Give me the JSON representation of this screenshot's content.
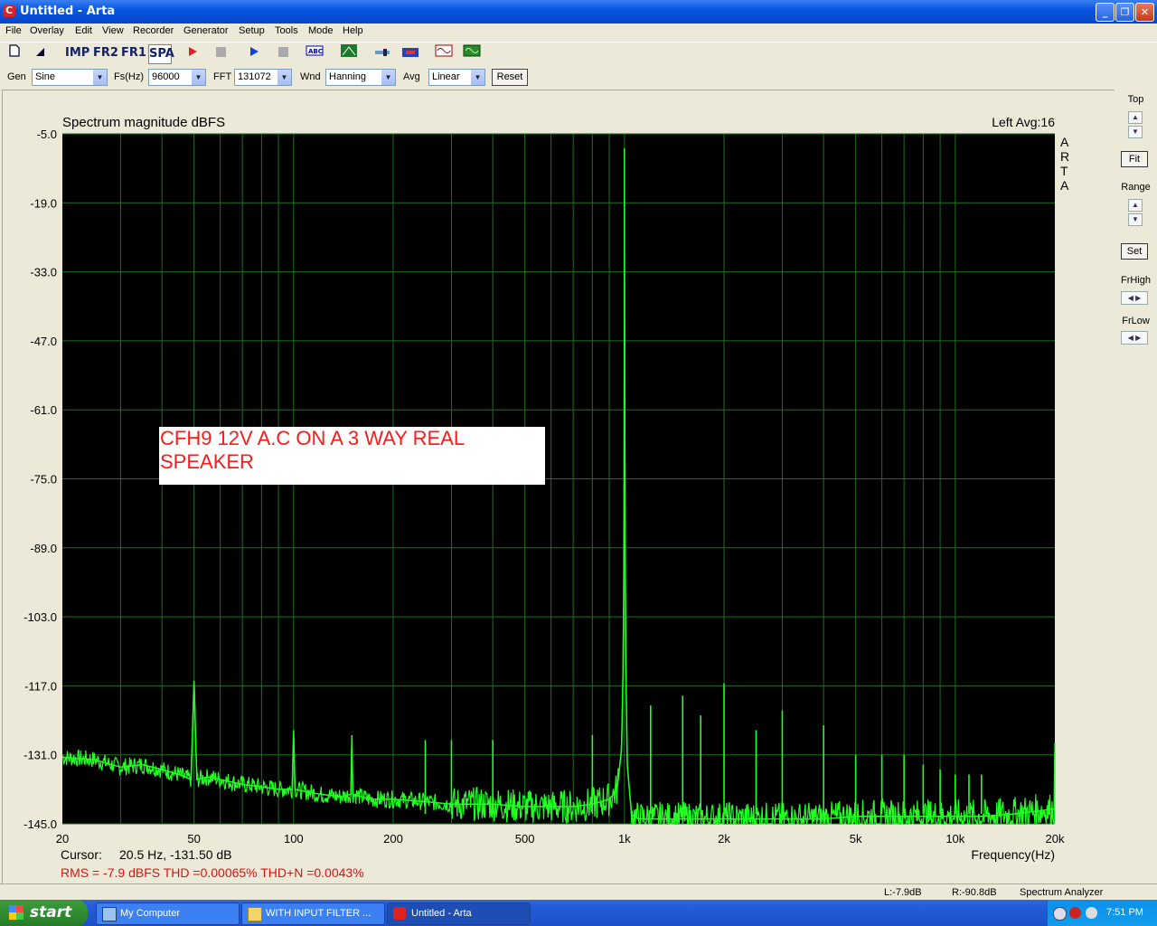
{
  "window": {
    "title": "Untitled - Arta",
    "app_icon_letter": "C",
    "minimize": "_",
    "maximize": "❐",
    "close": "✕"
  },
  "menu": [
    "File",
    "Overlay",
    "Edit",
    "View",
    "Recorder",
    "Generator",
    "Setup",
    "Tools",
    "Mode",
    "Help"
  ],
  "toolbar": {
    "imp": "IMP",
    "fr2": "FR2",
    "fr1": "FR1",
    "spa": "SPA"
  },
  "controls": {
    "gen_label": "Gen",
    "gen_value": "Sine",
    "fs_label": "Fs(Hz)",
    "fs_value": "96000",
    "fft_label": "FFT",
    "fft_value": "131072",
    "wnd_label": "Wnd",
    "wnd_value": "Hanning",
    "avg_label": "Avg",
    "avg_value": "Linear",
    "reset": "Reset"
  },
  "side": {
    "top": "Top",
    "fit": "Fit",
    "range": "Range",
    "set": "Set",
    "frhigh": "FrHigh",
    "frlow": "FrLow"
  },
  "plot": {
    "title": "Spectrum magnitude dBFS",
    "channel_info": "Left  Avg:16",
    "brand": [
      "A",
      "R",
      "T",
      "A"
    ],
    "annotation_line1": "CFH9 12V A.C ON A 3 WAY REAL",
    "annotation_line2": "SPEAKER",
    "cursor_label": "Cursor:",
    "cursor_value": "20.5 Hz, -131.50 dB",
    "xlabel": "Frequency(Hz)",
    "measurements": "RMS =   -7.9 dBFS   THD =0.00065%   THD+N =0.0043%"
  },
  "chart_data": {
    "type": "line",
    "title": "Spectrum magnitude dBFS",
    "xlabel": "Frequency(Hz)",
    "ylabel": "",
    "xscale": "log",
    "xlim": [
      20,
      20000
    ],
    "ylim": [
      -145,
      -5
    ],
    "yticks": [
      "-5.0",
      "-19.0",
      "-33.0",
      "-47.0",
      "-61.0",
      "-75.0",
      "-89.0",
      "-103.0",
      "-117.0",
      "-131.0",
      "-145.0"
    ],
    "xticks": [
      {
        "v": 20,
        "l": "20"
      },
      {
        "v": 50,
        "l": "50"
      },
      {
        "v": 100,
        "l": "100"
      },
      {
        "v": 200,
        "l": "200"
      },
      {
        "v": 500,
        "l": "500"
      },
      {
        "v": 1000,
        "l": "1k"
      },
      {
        "v": 2000,
        "l": "2k"
      },
      {
        "v": 5000,
        "l": "5k"
      },
      {
        "v": 10000,
        "l": "10k"
      },
      {
        "v": 20000,
        "l": "20k"
      }
    ],
    "line_color": "#22ff22",
    "background": "#000000",
    "grid_color": "#1f6e1f",
    "series": [
      {
        "x": [
          20,
          25,
          30,
          35,
          40,
          45,
          49,
          50,
          51,
          55,
          60,
          70,
          80,
          90,
          99,
          100,
          101,
          110,
          120,
          140,
          149,
          150,
          151,
          170,
          190,
          200,
          250,
          300,
          400,
          500,
          600,
          700,
          800,
          900,
          950,
          980,
          990,
          995,
          998,
          1000,
          1002,
          1005,
          1010,
          1020,
          1050,
          1100,
          1500,
          2000,
          3000,
          4000,
          5000,
          6000,
          7000,
          8000,
          10000,
          12000,
          15000,
          19900,
          20000
        ],
        "y": [
          -131.5,
          -132,
          -133.5,
          -133,
          -134,
          -135,
          -136,
          -116,
          -136,
          -135.5,
          -136,
          -137,
          -137.5,
          -138,
          -138,
          -126,
          -138,
          -138.5,
          -139,
          -139.5,
          -139,
          -127,
          -139,
          -140,
          -140,
          -140,
          -140.5,
          -141,
          -141,
          -141.5,
          -141.5,
          -141.5,
          -141,
          -140,
          -138,
          -130,
          -115,
          -98,
          -75,
          -8,
          -60,
          -88,
          -113,
          -133,
          -143,
          -144,
          -144,
          -144,
          -144,
          -144,
          -143.5,
          -143.5,
          -143.5,
          -143.5,
          -143.5,
          -143.5,
          -143,
          -142,
          -130.5
        ]
      }
    ],
    "harmonic_spikes": [
      {
        "f": 2000,
        "db": -116.5
      },
      {
        "f": 3000,
        "db": -122
      },
      {
        "f": 4000,
        "db": -125
      },
      {
        "f": 5000,
        "db": -131
      },
      {
        "f": 6000,
        "db": -131
      },
      {
        "f": 7000,
        "db": -131
      },
      {
        "f": 8000,
        "db": -133
      },
      {
        "f": 9000,
        "db": -134
      },
      {
        "f": 10000,
        "db": -135
      },
      {
        "f": 11000,
        "db": -135
      },
      {
        "f": 12000,
        "db": -135
      },
      {
        "f": 1500,
        "db": -119
      },
      {
        "f": 1200,
        "db": -121
      },
      {
        "f": 1700,
        "db": -123
      },
      {
        "f": 2500,
        "db": -126
      },
      {
        "f": 250,
        "db": -128
      },
      {
        "f": 300,
        "db": -128
      },
      {
        "f": 400,
        "db": -128
      },
      {
        "f": 800,
        "db": -127
      }
    ],
    "hum_spikes": [
      {
        "f": 50,
        "db": -116
      },
      {
        "f": 100,
        "db": -126
      },
      {
        "f": 150,
        "db": -127
      }
    ]
  },
  "status": {
    "left": "L:-7.9dB",
    "right": "R:-90.8dB",
    "mode": "Spectrum Analyzer"
  },
  "taskbar": {
    "start": "start",
    "tasks": [
      "My Computer",
      "WITH INPUT FILTER ...",
      "Untitled - Arta"
    ],
    "clock": "7:51 PM"
  }
}
